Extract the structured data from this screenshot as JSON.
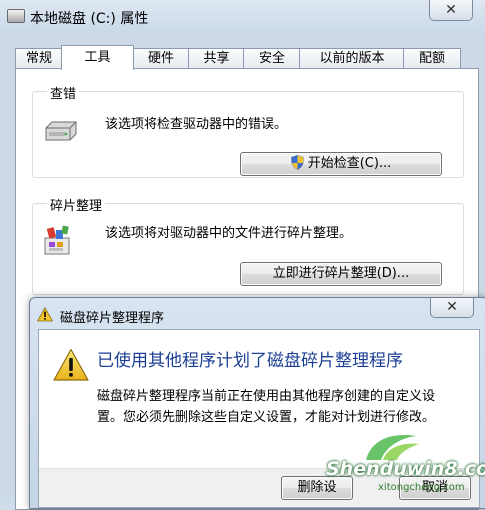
{
  "window": {
    "title": "本地磁盘 (C:) 属性",
    "close_glyph": "✕"
  },
  "tabs": [
    {
      "label": "常规",
      "active": false
    },
    {
      "label": "工具",
      "active": true
    },
    {
      "label": "硬件",
      "active": false
    },
    {
      "label": "共享",
      "active": false
    },
    {
      "label": "安全",
      "active": false
    },
    {
      "label": "以前的版本",
      "active": false
    },
    {
      "label": "配额",
      "active": false
    }
  ],
  "error_check": {
    "title": "查错",
    "description": "该选项将检查驱动器中的错误。",
    "button_label": "开始检查(C)..."
  },
  "defrag": {
    "title": "碎片整理",
    "description": "该选项将对驱动器中的文件进行碎片整理。",
    "button_label": "立即进行碎片整理(D)..."
  },
  "dialog": {
    "title": "磁盘碎片整理程序",
    "close_glyph": "✕",
    "heading": "已使用其他程序计划了磁盘碎片整理程序",
    "message": "磁盘碎片整理程序当前正在使用由其他程序创建的自定义设置。您必须先删除这些自定义设置，才能对计划进行修改。",
    "delete_button_label": "删除设",
    "cancel_button_label": "取消"
  },
  "watermark": {
    "main": "Shenduwin8.com",
    "sub": "xitongcheng.com"
  },
  "colors": {
    "dialog_heading": "#1c3f94",
    "window_frame": "#c9d8e8",
    "warning_yellow": "#f4c430"
  }
}
